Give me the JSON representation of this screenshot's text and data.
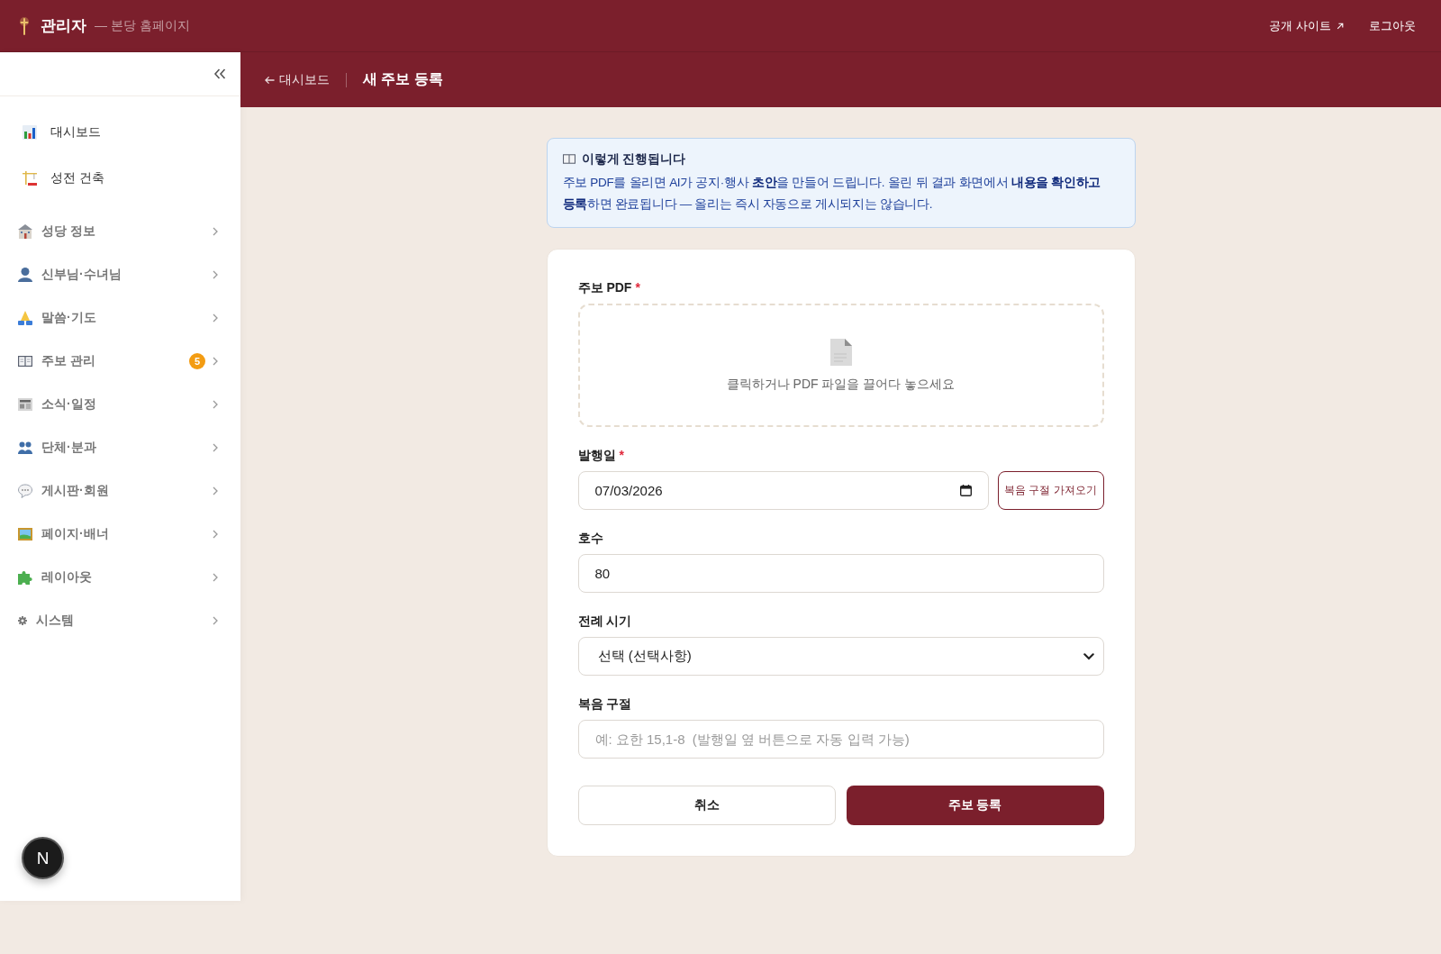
{
  "top_bar": {
    "title": "관리자",
    "subtitle": "— 본당 홈페이지",
    "links": [
      {
        "label": "공개 사이트",
        "kind": "external"
      },
      {
        "label": "로그아웃",
        "kind": "plain"
      }
    ]
  },
  "sidebar": {
    "items": [
      {
        "label": "대시보드",
        "kind": "link"
      },
      {
        "label": "성전 건축",
        "kind": "link"
      },
      {
        "label": "성당 정보",
        "kind": "group",
        "expanded": false
      },
      {
        "label": "신부님·수녀님",
        "kind": "group",
        "expanded": false
      },
      {
        "label": "말씀·기도",
        "kind": "group",
        "expanded": false
      },
      {
        "label": "주보 관리",
        "kind": "group",
        "expanded": false,
        "badge": "5"
      },
      {
        "label": "소식·일정",
        "kind": "group",
        "expanded": false
      },
      {
        "label": "단체·분과",
        "kind": "group",
        "expanded": false
      },
      {
        "label": "게시판·회원",
        "kind": "group",
        "expanded": false
      },
      {
        "label": "페이지·배너",
        "kind": "group",
        "expanded": false
      },
      {
        "label": "레이아웃",
        "kind": "group",
        "expanded": false
      },
      {
        "label": "시스템",
        "kind": "group",
        "expanded": false
      }
    ]
  },
  "header": {
    "back_link": "대시보드",
    "title": "새 주보 등록"
  },
  "info_box": {
    "title": "이렇게 진행됩니다",
    "text": "주보 PDF를 올리면 AI가 공지·행사 **초안**을 만들어 드립니다. 올린 뒤 결과 화면에서 **내용을 확인하고 등록**하면 완료됩니다 — 올리는 즉시 자동으로 게시되지는 않습니다."
  },
  "form": {
    "fields": [
      {
        "kind": "file",
        "label": "주보 PDF",
        "required_mark": "*",
        "hint": "클릭하거나 PDF 파일을 끌어다 놓으세요"
      },
      {
        "kind": "date",
        "label": "발행일",
        "required_mark": "*",
        "value": "07/03/2026",
        "action": "복음 구절 가져오기"
      },
      {
        "kind": "text",
        "label": "호수",
        "value": "80"
      },
      {
        "kind": "select",
        "label": "전례 시기",
        "value": "선택 (선택사항)"
      },
      {
        "kind": "text",
        "label": "복음 구절",
        "placeholder": "예: 요한 15,1-8  (발행일 옆 버튼으로 자동 입력 가능)"
      }
    ],
    "buttons": [
      {
        "label": "취소",
        "kind": "secondary"
      },
      {
        "label": "주보 등록",
        "kind": "primary"
      }
    ]
  },
  "dev_button": {
    "label": "N"
  }
}
